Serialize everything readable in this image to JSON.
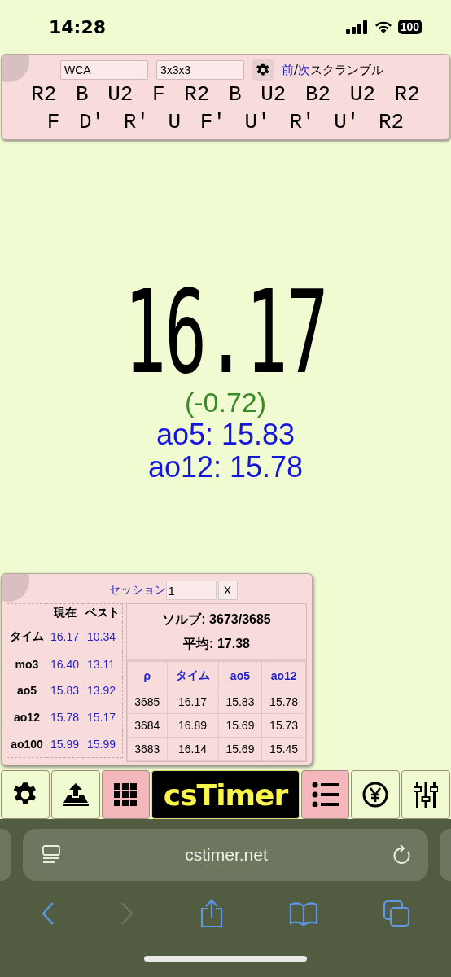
{
  "status_bar": {
    "time": "14:28",
    "battery": "100"
  },
  "scramble_panel": {
    "type_field": {
      "value": "WCA"
    },
    "puzzle_field": {
      "value": "3x3x3"
    },
    "prev_link": "前",
    "separator": "/",
    "next_link": "次",
    "scramble_label": "スクランブル",
    "lines": [
      "R2 B U2 F R2 B U2 B2 U2 R2",
      "F D' R' U F' U' R' U' R2"
    ]
  },
  "timer": {
    "time": "16.17",
    "delta": "(-0.72)",
    "averages": [
      "ao5: 15.83",
      "ao12: 15.78"
    ]
  },
  "stats_panel": {
    "session_label": "セッション",
    "session_field": {
      "value": "1"
    },
    "close_button": "X",
    "summary": {
      "columns": [
        "現在",
        "ベスト"
      ],
      "rows": [
        {
          "label": "タイム",
          "current": "16.17",
          "best": "10.34"
        },
        {
          "label": "mo3",
          "current": "16.40",
          "best": "13.11"
        },
        {
          "label": "ao5",
          "current": "15.83",
          "best": "13.92"
        },
        {
          "label": "ao12",
          "current": "15.78",
          "best": "15.17"
        },
        {
          "label": "ao100",
          "current": "15.99",
          "best": "15.99"
        }
      ]
    },
    "solves": "ソルブ: 3673/3685",
    "mean": "平均: 17.38",
    "table": {
      "columns": [
        "ρ",
        "タイム",
        "ao5",
        "ao12"
      ],
      "rows": [
        [
          "3685",
          "16.17",
          "15.83",
          "15.78"
        ],
        [
          "3684",
          "16.89",
          "15.69",
          "15.73"
        ],
        [
          "3683",
          "16.14",
          "15.69",
          "15.45"
        ]
      ]
    }
  },
  "toolbar": [
    {
      "kind": "gear",
      "selected": false
    },
    {
      "kind": "export",
      "selected": false
    },
    {
      "kind": "grid",
      "selected": true
    },
    {
      "kind": "logo",
      "label": "csTimer",
      "selected": false
    },
    {
      "kind": "list",
      "selected": true
    },
    {
      "kind": "yen",
      "selected": false
    },
    {
      "kind": "sliders",
      "selected": false
    }
  ],
  "browser": {
    "url": "cstimer.net"
  }
}
